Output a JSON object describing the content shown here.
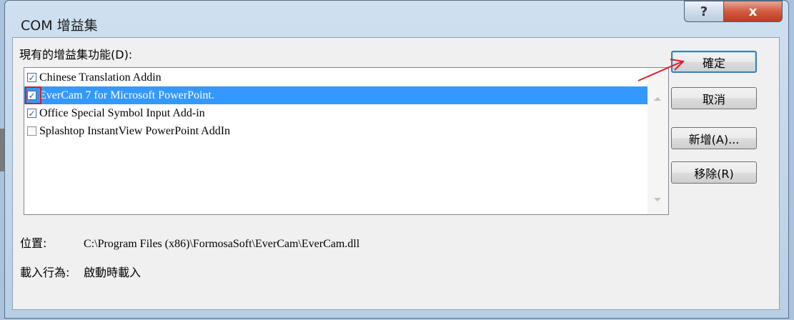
{
  "dialog": {
    "title": "COM 增益集",
    "help_glyph": "?",
    "close_glyph": "x"
  },
  "list": {
    "label": "現有的增益集功能(D):",
    "items": [
      {
        "label": "Chinese Translation Addin",
        "checked": true,
        "selected": false
      },
      {
        "label": "EverCam 7 for Microsoft PowerPoint.",
        "checked": true,
        "selected": true
      },
      {
        "label": "Office Special Symbol Input Add-in",
        "checked": true,
        "selected": false
      },
      {
        "label": "Splashtop InstantView PowerPoint AddIn",
        "checked": false,
        "selected": false
      }
    ]
  },
  "buttons": {
    "ok": "確定",
    "cancel": "取消",
    "add": "新增(A)...",
    "remove": "移除(R)"
  },
  "details": {
    "location_label": "位置:",
    "location_value": "C:\\Program Files (x86)\\FormosaSoft\\EverCam\\EverCam.dll",
    "load_behavior_label": "載入行為:",
    "load_behavior_value": "啟動時載入"
  },
  "colors": {
    "selection": "#3399ff",
    "annotation": "#e01a23"
  }
}
